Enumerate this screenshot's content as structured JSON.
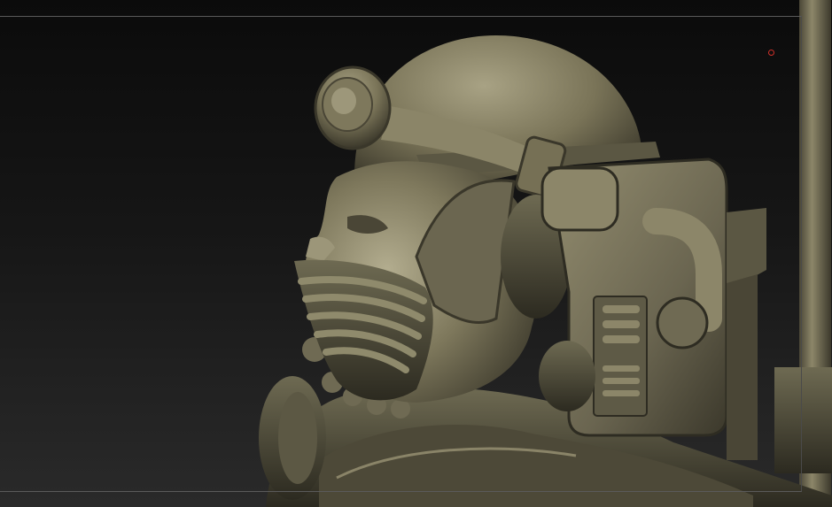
{
  "app": {
    "viewport_label": "",
    "accent_marker_color": "#d0302a",
    "clay_base_color": "#6e6a52",
    "clay_highlight_color": "#a8a284",
    "clay_shadow_color": "#2c2a20",
    "background_top_color": "#0b0b0b",
    "background_bottom_color": "#2a2a2a"
  },
  "scene": {
    "subject": "sculpted-bust",
    "material": "clay-matcap"
  }
}
